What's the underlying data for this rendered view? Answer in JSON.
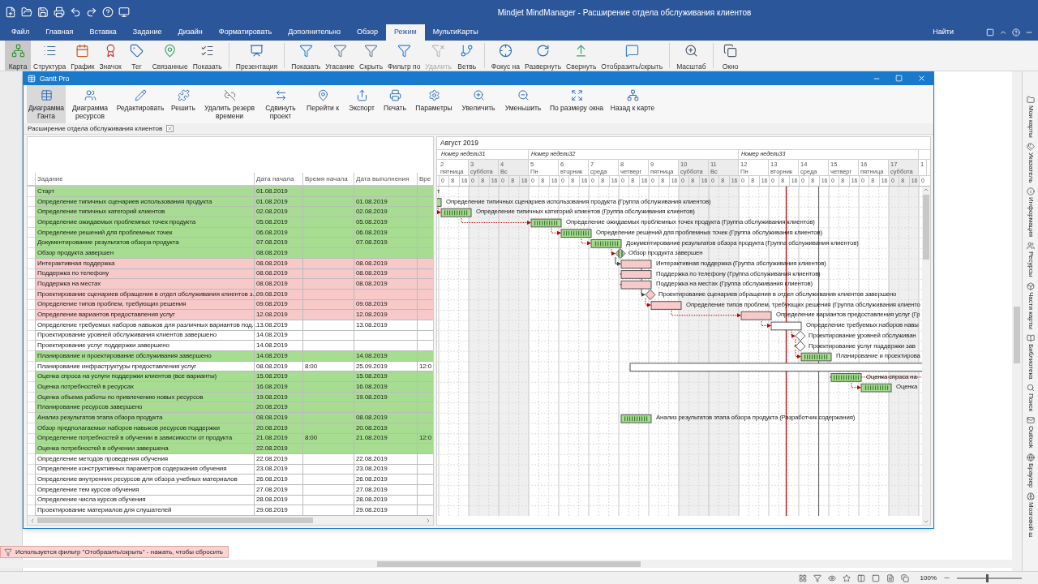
{
  "app": {
    "title": "Mindjet MindManager - Расширение отдела обслуживания клиентов"
  },
  "menu_tabs": [
    {
      "label": "Файл",
      "selected": false
    },
    {
      "label": "Главная",
      "selected": false
    },
    {
      "label": "Вставка",
      "selected": false
    },
    {
      "label": "Задание",
      "selected": false
    },
    {
      "label": "Дизайн",
      "selected": false
    },
    {
      "label": "Форматировать",
      "selected": false
    },
    {
      "label": "Дополнительно",
      "selected": false
    },
    {
      "label": "Обзор",
      "selected": false
    },
    {
      "label": "Режим",
      "selected": true
    },
    {
      "label": "МультиКарты",
      "selected": false
    }
  ],
  "search_label": "Найти",
  "ribbon": [
    {
      "label": "Карта",
      "selected": true,
      "disabled": false
    },
    {
      "label": "Структура",
      "selected": false,
      "disabled": false
    },
    {
      "label": "График",
      "selected": false,
      "disabled": false
    },
    {
      "label": "Значок",
      "selected": false,
      "disabled": false
    },
    {
      "label": "Тег",
      "selected": false,
      "disabled": false
    },
    {
      "label": "Связанные",
      "selected": false,
      "disabled": false
    },
    {
      "label": "Показать",
      "selected": false,
      "disabled": false
    },
    {
      "label": "Презентация",
      "selected": false,
      "disabled": false
    },
    {
      "label": "Показать",
      "selected": false,
      "disabled": false
    },
    {
      "label": "Угасание",
      "selected": false,
      "disabled": false
    },
    {
      "label": "Скрыть",
      "selected": false,
      "disabled": false
    },
    {
      "label": "Фильтр по",
      "selected": false,
      "disabled": false
    },
    {
      "label": "Удалить",
      "selected": false,
      "disabled": true
    },
    {
      "label": "Ветвь",
      "selected": false,
      "disabled": false
    },
    {
      "label": "Фокус на",
      "selected": false,
      "disabled": false
    },
    {
      "label": "Развернуть",
      "selected": false,
      "disabled": false
    },
    {
      "label": "Свернуть",
      "selected": false,
      "disabled": false
    },
    {
      "label": "Отобразить/скрыть",
      "selected": false,
      "disabled": false
    },
    {
      "label": "Масштаб",
      "selected": false,
      "disabled": false
    },
    {
      "label": "Окно",
      "selected": false,
      "disabled": false
    }
  ],
  "side_panel": [
    "Мои карты",
    "Указатель",
    "Информация",
    "Ресурсы",
    "Части карты",
    "Библиотека",
    "Поиск",
    "Outlook",
    "Браузер",
    "Мозговой ш"
  ],
  "gantt_window": {
    "title": "Gantt Pro",
    "toolbar": [
      {
        "label": "Диаграмма Ганта",
        "selected": true
      },
      {
        "label": "Диаграмма ресурсов",
        "selected": false
      },
      {
        "label": "Редактировать",
        "selected": false
      },
      {
        "label": "Решить",
        "selected": false
      },
      {
        "label": "Удалить резерв времени",
        "selected": false
      },
      {
        "label": "Сдвинуть проект",
        "selected": false
      },
      {
        "label": "Перейти к",
        "selected": false
      },
      {
        "label": "Экспорт",
        "selected": false
      },
      {
        "label": "Печать",
        "selected": false
      },
      {
        "label": "Параметры",
        "selected": false
      },
      {
        "label": "Увеличить",
        "selected": false
      },
      {
        "label": "Уменьшить",
        "selected": false
      },
      {
        "label": "По размеру окна",
        "selected": false
      },
      {
        "label": "Назад к карте",
        "selected": false
      }
    ],
    "doc_tab": "Расширение отдела обслуживания клиентов",
    "table": {
      "columns": [
        "Задание",
        "Дата начала",
        "Время начала",
        "Дата выполнения",
        "Вре"
      ],
      "rows": [
        {
          "task": "Старт",
          "start": "01.08.2019",
          "kind": "milestone",
          "color": "#a6dd90",
          "gantt_label": "т"
        },
        {
          "task": "Определение типичных сценариев использования продукта",
          "start": "01.08.2019",
          "due": "01.08.2019",
          "kind": "task",
          "color": "#a6dd90",
          "gantt_label": "Определение типичных сценариев использования продукта (Группа обслуживания клиентов)"
        },
        {
          "task": "Определение типичных категорий клиентов",
          "start": "02.08.2019",
          "due": "02.08.2019",
          "kind": "task",
          "color": "#a6dd90",
          "done": true,
          "critical": true,
          "gantt_label": "Определение типичных категорий клиентов (Группа обслуживания клиентов)"
        },
        {
          "task": "Определение ожидаемых проблемных точек продукта",
          "start": "05.08.2019",
          "due": "05.08.2019",
          "kind": "task",
          "color": "#a6dd90",
          "done": true,
          "critical": true,
          "gantt_label": "Определение ожидаемых проблемных точек продукта (Группа обслуживания клиентов)"
        },
        {
          "task": "Определение решений для проблемных точек",
          "start": "06.08.2019",
          "due": "06.08.2019",
          "kind": "task",
          "color": "#a6dd90",
          "done": true,
          "critical": true,
          "gantt_label": "Определение решений для проблемных точек (Группа обслуживания клиентов)"
        },
        {
          "task": "Документирование результатов обзора продукта",
          "start": "07.08.2019",
          "due": "07.08.2019",
          "kind": "task",
          "color": "#a6dd90",
          "done": true,
          "critical": true,
          "gantt_label": "Документирование результатов обзора продукта (Группа обслуживания клиентов)"
        },
        {
          "task": "Обзор продукта завершен",
          "start": "08.08.2019",
          "kind": "milestone",
          "color": "#a6dd90",
          "done": true,
          "critical": true,
          "gantt_label": "Обзор продукта завершен"
        },
        {
          "task": "Интерактивная поддержка",
          "start": "08.08.2019",
          "due": "08.08.2019",
          "kind": "task",
          "color": "#f7c9c9",
          "done": false,
          "critical": false,
          "gantt_label": "Интерактивная поддержка (Группа обслуживания клиентов)"
        },
        {
          "task": "Поддержка по телефону",
          "start": "08.08.2019",
          "due": "08.08.2019",
          "kind": "task",
          "color": "#f7c9c9",
          "done": false,
          "critical": false,
          "gantt_label": "Поддержка по телефону (Группа обслуживания клиентов)"
        },
        {
          "task": "Поддержка на местах",
          "start": "08.08.2019",
          "due": "08.08.2019",
          "kind": "task",
          "color": "#f7c9c9",
          "done": false,
          "critical": false,
          "gantt_label": "Поддержка на местах (Группа обслуживания клиентов)"
        },
        {
          "task": "Проектирование сценариев обращения в отдел обслуживания клиентов з...",
          "start": "09.08.2019",
          "kind": "milestone",
          "color": "#f7c9c9",
          "done": false,
          "critical": false,
          "gantt_label": "Проектирование сценариев обращения в отдел обслуживания клиентов завершено"
        },
        {
          "task": "Определение типов проблем, требующих решения",
          "start": "09.08.2019",
          "due": "09.08.2019",
          "kind": "task",
          "color": "#f7c9c9",
          "done": false,
          "critical": true,
          "gantt_label": "Определение типов проблем, требующих решения (Группа обслуживания клиенто"
        },
        {
          "task": "Определение вариантов предоставления услуг",
          "start": "12.08.2019",
          "due": "12.08.2019",
          "kind": "task",
          "color": "#f7c9c9",
          "done": false,
          "critical": true,
          "gantt_label": "Определение вариантов предоставления услуг (Гр"
        },
        {
          "task": "Определение требуемых наборов навыков для различных вариантов под...",
          "start": "13.08.2019",
          "due": "13.08.2019",
          "kind": "task",
          "color": "#ffffff",
          "done": false,
          "critical": true,
          "gantt_label": "Определение требуемых наборов навы"
        },
        {
          "task": "Проектирование уровней обслуживания клиентов завершено",
          "start": "14.08.2019",
          "kind": "milestone",
          "color": "#ffffff",
          "done": false,
          "critical": true,
          "gantt_label": "Проектирование уровней обслуживан"
        },
        {
          "task": "Проектирование услуг поддержки завершено",
          "start": "14.08.2019",
          "kind": "milestone",
          "color": "#ffffff",
          "done": false,
          "critical": true,
          "gantt_label": "Проектирование услуг поддержки зав"
        },
        {
          "task": "Планирование и проектирование обслуживания завершено",
          "start": "14.08.2019",
          "due": "14.08.2019",
          "kind": "task",
          "color": "#a6dd90",
          "done": true,
          "critical": true,
          "gantt_label": "Планирование и проектирова"
        },
        {
          "task": "Планирование инфраструктуры предоставления услуг",
          "start": "08.08.2019",
          "time": "8:00",
          "due": "25.09.2019",
          "column_5": "12:0",
          "kind": "summary",
          "color": "#ffffff"
        },
        {
          "task": "Оценка спроса на услуги поддержки клиентов (все варианты)",
          "start": "15.08.2019",
          "due": "15.08.2019",
          "kind": "task",
          "color": "#a6dd90",
          "done": true,
          "critical": true,
          "gantt_label": "Оценка спроса на"
        },
        {
          "task": "Оценка потребностей в ресурсах",
          "start": "16.08.2019",
          "due": "16.08.2019",
          "kind": "task",
          "color": "#a6dd90",
          "done": true,
          "critical": true,
          "gantt_label": "Оценка"
        },
        {
          "task": "Оценка объема работы по привлечению новых ресурсов",
          "start": "19.08.2019",
          "due": "19.08.2019",
          "kind": "task",
          "color": "#a6dd90"
        },
        {
          "task": "Планирование ресурсов завершено",
          "start": "20.08.2019",
          "kind": "milestone",
          "color": "#a6dd90"
        },
        {
          "task": "Анализ результатов этапа обзора продукта",
          "start": "08.08.2019",
          "due": "08.08.2019",
          "kind": "task",
          "color": "#a6dd90",
          "done": true,
          "gantt_label": "Анализ результатов этапа обзора продукта (Разработчик содержания)"
        },
        {
          "task": "Обзор предполагаемых наборов навыков ресурсов поддержки",
          "start": "20.08.2019",
          "due": "20.08.2019",
          "kind": "task",
          "color": "#a6dd90"
        },
        {
          "task": "Определение потребностей в обучении в зависимости от продукта",
          "start": "21.08.2019",
          "time": "8:00",
          "due": "21.08.2019",
          "column_5": "12:0",
          "kind": "task",
          "color": "#a6dd90"
        },
        {
          "task": "Оценка потребностей в обучении завершена",
          "start": "22.08.2019",
          "kind": "milestone",
          "color": "#a6dd90"
        },
        {
          "task": "Определение методов проведения обучения",
          "start": "22.08.2019",
          "due": "22.08.2019",
          "kind": "task",
          "color": "#ffffff"
        },
        {
          "task": "Определение конструктивных параметров содержания обучения",
          "start": "23.08.2019",
          "due": "23.08.2019",
          "kind": "task",
          "color": "#ffffff"
        },
        {
          "task": "Определение внутренних ресурсов для обзора учебных материалов",
          "start": "26.08.2019",
          "due": "26.08.2019",
          "kind": "task",
          "color": "#ffffff"
        },
        {
          "task": "Определение тем курсов обучения",
          "start": "27.08.2019",
          "due": "27.08.2019",
          "kind": "task",
          "color": "#ffffff"
        },
        {
          "task": "Определение числа курсов обучения",
          "start": "28.08.2019",
          "due": "28.08.2019",
          "kind": "task",
          "color": "#ffffff"
        },
        {
          "task": "Проектирование материалов для слушателей",
          "start": "29.08.2019",
          "due": "29.08.2019",
          "kind": "task",
          "color": "#ffffff"
        }
      ]
    },
    "timeline": {
      "month": "Август 2019",
      "weeks": [
        "Номер недели31",
        "Номер недели32",
        "Номер недели33"
      ],
      "days": [
        {
          "num": "2",
          "weekday": "пятница",
          "weekend": false,
          "hours": [
            "0",
            "8",
            "16"
          ]
        },
        {
          "num": "3",
          "weekday": "суббота",
          "weekend": true,
          "hours": [
            "0",
            "8",
            "16"
          ]
        },
        {
          "num": "4",
          "weekday": "Вс",
          "weekend": true,
          "hours": [
            "0",
            "8",
            "16"
          ]
        },
        {
          "num": "5",
          "weekday": "Пн",
          "weekend": false,
          "hours": [
            "0",
            "8",
            "16"
          ]
        },
        {
          "num": "6",
          "weekday": "вторник",
          "weekend": false,
          "hours": [
            "0",
            "8",
            "16"
          ]
        },
        {
          "num": "7",
          "weekday": "среда",
          "weekend": false,
          "hours": [
            "0",
            "8",
            "16"
          ]
        },
        {
          "num": "8",
          "weekday": "четверг",
          "weekend": false,
          "hours": [
            "0",
            "8",
            "16"
          ]
        },
        {
          "num": "9",
          "weekday": "пятница",
          "weekend": false,
          "hours": [
            "0",
            "8",
            "16"
          ]
        },
        {
          "num": "10",
          "weekday": "суббота",
          "weekend": true,
          "hours": [
            "0",
            "8",
            "16"
          ]
        },
        {
          "num": "11",
          "weekday": "Вс",
          "weekend": true,
          "hours": [
            "0",
            "8",
            "16"
          ]
        },
        {
          "num": "12",
          "weekday": "Пн",
          "weekend": false,
          "hours": [
            "0",
            "8",
            "16"
          ]
        },
        {
          "num": "13",
          "weekday": "вторник",
          "weekend": false,
          "hours": [
            "0",
            "8",
            "16"
          ]
        },
        {
          "num": "14",
          "weekday": "среда",
          "weekend": false,
          "hours": [
            "0",
            "8",
            "16"
          ]
        },
        {
          "num": "15",
          "weekday": "четверг",
          "weekend": false,
          "hours": [
            "0",
            "8",
            "16"
          ]
        },
        {
          "num": "16",
          "weekday": "пятница",
          "weekend": false,
          "hours": [
            "0",
            "8",
            "16"
          ]
        },
        {
          "num": "17",
          "weekday": "суббота",
          "weekend": true,
          "hours": [
            "0",
            "8",
            "16"
          ]
        },
        {
          "num": "1",
          "weekend": false,
          "hours": [
            "0"
          ]
        }
      ]
    }
  },
  "filter_notice": "Используется фильтр \"Отобразить/скрыть\" - нажать, чтобы сбросить",
  "zoom_level": "100%",
  "zoom_slider": {
    "level": 0.47
  }
}
